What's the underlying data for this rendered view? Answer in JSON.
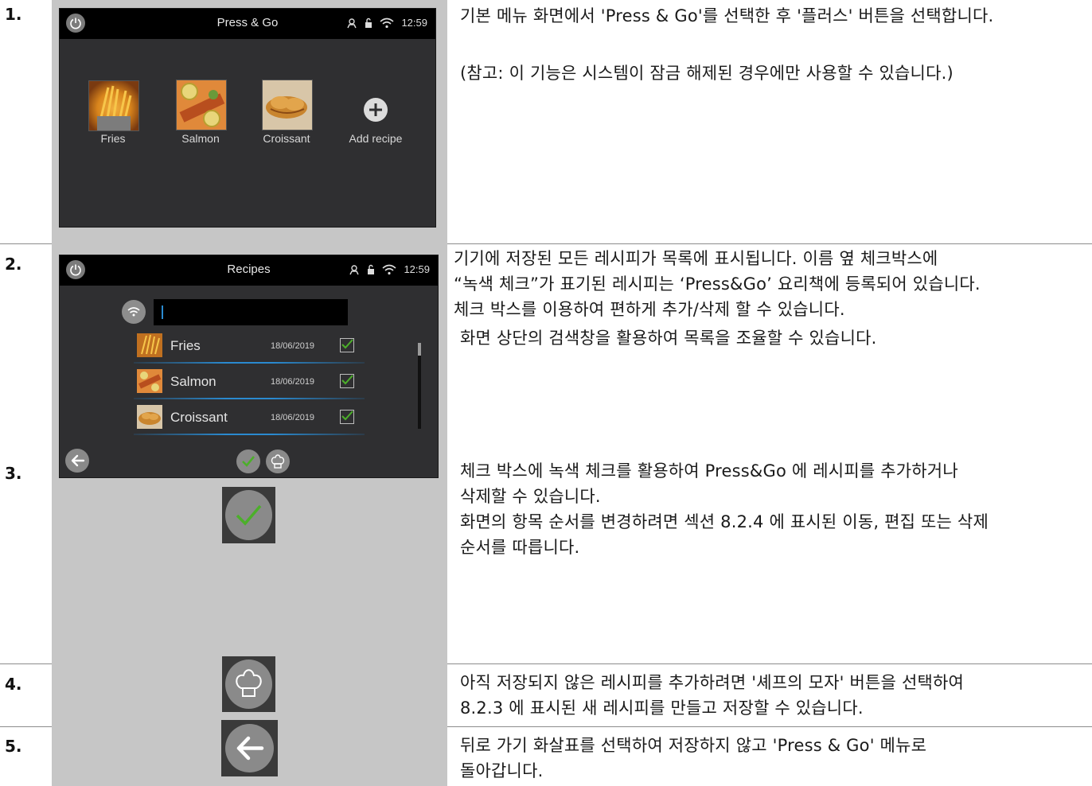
{
  "steps": [
    {
      "number": "1.",
      "text": [
        "기본 메뉴 화면에서 'Press & Go'를 선택한 후 '플러스' 버튼을 선택합니다.",
        "(참고: 이 기능은 시스템이 잠금 해제된 경우에만 사용할 수 있습니다.)"
      ]
    },
    {
      "number": "2.",
      "text": [
        "기기에 저장된 모든 레시피가 목록에 표시됩니다. 이름 옆 체크박스에",
        "“녹색 체크”가 표기된 레시피는 ‘Press&Go’ 요리책에 등록되어 있습니다.",
        "체크 박스를 이용하여 편하게 추가/삭제 할 수 있습니다.",
        "화면 상단의 검색창을 활용하여 목록을 조율할 수 있습니다."
      ]
    },
    {
      "number": "3.",
      "text": [
        "체크 박스에 녹색 체크를 활용하여 Press&Go 에 레시피를 추가하거나",
        "삭제할 수 있습니다.",
        "화면의 항목 순서를 변경하려면 섹션 8.2.4 에 표시된 이동, 편집 또는 삭제",
        "순서를 따릅니다."
      ]
    },
    {
      "number": "4.",
      "text": [
        "아직 저장되지 않은 레시피를 추가하려면 '셰프의 모자' 버튼을 선택하여",
        "8.2.3 에 표시된 새 레시피를 만들고 저장할 수 있습니다."
      ]
    },
    {
      "number": "5.",
      "text": [
        "뒤로 가기 화살표를 선택하여 저장하지 않고 'Press & Go' 메뉴로",
        "돌아갑니다."
      ]
    }
  ],
  "screen1": {
    "title": "Press & Go",
    "time": "12:59",
    "tiles": [
      {
        "label": "Fries",
        "icon": "fries-photo"
      },
      {
        "label": "Salmon",
        "icon": "salmon-photo"
      },
      {
        "label": "Croissant",
        "icon": "croissant-photo"
      },
      {
        "label": "Add recipe",
        "icon": "plus-icon"
      }
    ]
  },
  "screen2": {
    "title": "Recipes",
    "time": "12:59",
    "search_value": "",
    "recipes": [
      {
        "name": "Fries",
        "date": "18/06/2019",
        "checked": true
      },
      {
        "name": "Salmon",
        "date": "18/06/2019",
        "checked": true
      },
      {
        "name": "Croissant",
        "date": "18/06/2019",
        "checked": true
      }
    ]
  },
  "colors": {
    "check_green": "#4caf2a",
    "list_underline": "#2a8ad0",
    "screen_bg": "#2f2f31"
  }
}
